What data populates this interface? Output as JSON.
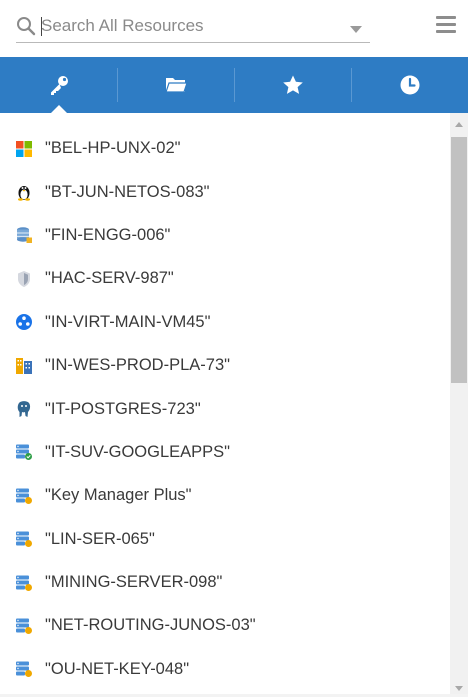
{
  "search": {
    "placeholder": "Search All Resources"
  },
  "tabs": [
    {
      "name": "key-icon",
      "active": true
    },
    {
      "name": "folder-icon",
      "active": false
    },
    {
      "name": "star-icon",
      "active": false
    },
    {
      "name": "clock-icon",
      "active": false
    }
  ],
  "colors": {
    "tabbar": "#2e7cc4",
    "active_indicator": "#ffffff"
  },
  "resources": [
    {
      "label": "\"BEL-HP-UNX-02\"",
      "icon": "windows-icon"
    },
    {
      "label": "\"BT-JUN-NETOS-083\"",
      "icon": "linux-tux-icon"
    },
    {
      "label": "\"FIN-ENGG-006\"",
      "icon": "database-server-icon"
    },
    {
      "label": "\"HAC-SERV-987\"",
      "icon": "shield-device-icon"
    },
    {
      "label": "\"IN-VIRT-MAIN-VM45\"",
      "icon": "virtual-machine-icon"
    },
    {
      "label": "\"IN-WES-PROD-PLA-73\"",
      "icon": "building-icon"
    },
    {
      "label": "\"IT-POSTGRES-723\"",
      "icon": "postgresql-icon"
    },
    {
      "label": "\"IT-SUV-GOOGLEAPPS\"",
      "icon": "server-green-icon"
    },
    {
      "label": "\"Key Manager Plus\"",
      "icon": "server-icon"
    },
    {
      "label": "\"LIN-SER-065\"",
      "icon": "server-icon"
    },
    {
      "label": "\"MINING-SERVER-098\"",
      "icon": "server-icon"
    },
    {
      "label": "\"NET-ROUTING-JUNOS-03\"",
      "icon": "server-icon"
    },
    {
      "label": "\"OU-NET-KEY-048\"",
      "icon": "server-icon"
    }
  ]
}
